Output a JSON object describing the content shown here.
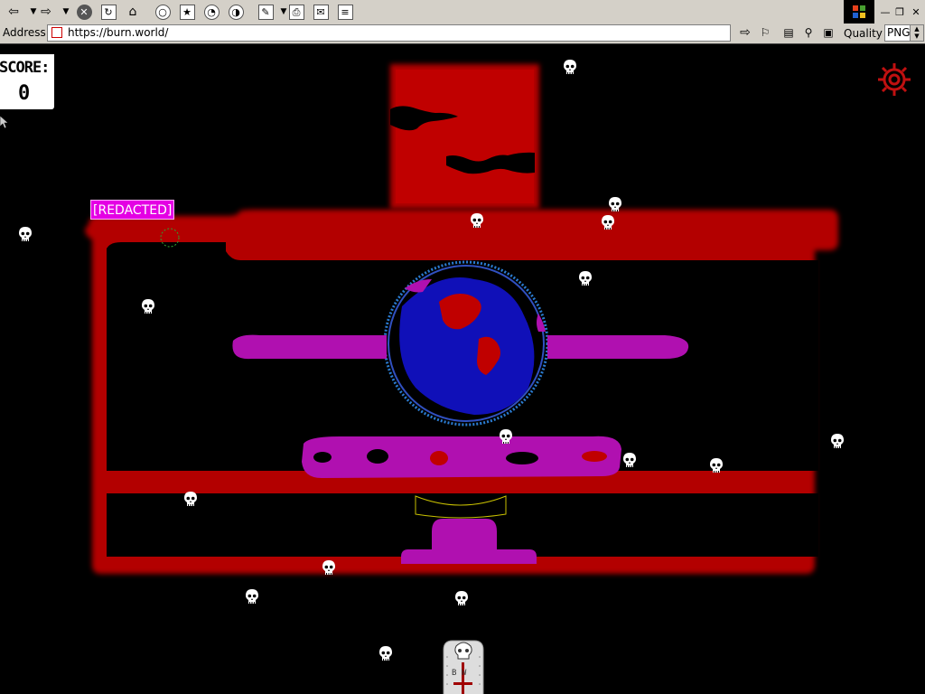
{
  "browser": {
    "address_label": "Address",
    "url": "https://burn.world/",
    "quality_label": "Quality",
    "quality_value": "PNG",
    "toolbar_icons": [
      "back-icon",
      "forward-icon",
      "stop-icon",
      "refresh-icon",
      "home-icon",
      "search-icon",
      "favorites-icon",
      "history-icon",
      "channels-icon",
      "edit-icon",
      "print-icon",
      "mail-icon",
      "page-icon"
    ]
  },
  "game": {
    "score_label": "SCORE:",
    "score_value": "0",
    "player_tag": "[REDACTED]",
    "tombstone_text": "B W",
    "colors": {
      "background": "#000000",
      "wall": "#b30000",
      "purple": "#b010b0",
      "blue": "#1010b8",
      "skull": "#ffffff",
      "tag": "#e400e4",
      "gear": "#c01010"
    },
    "skull_count": 18
  }
}
